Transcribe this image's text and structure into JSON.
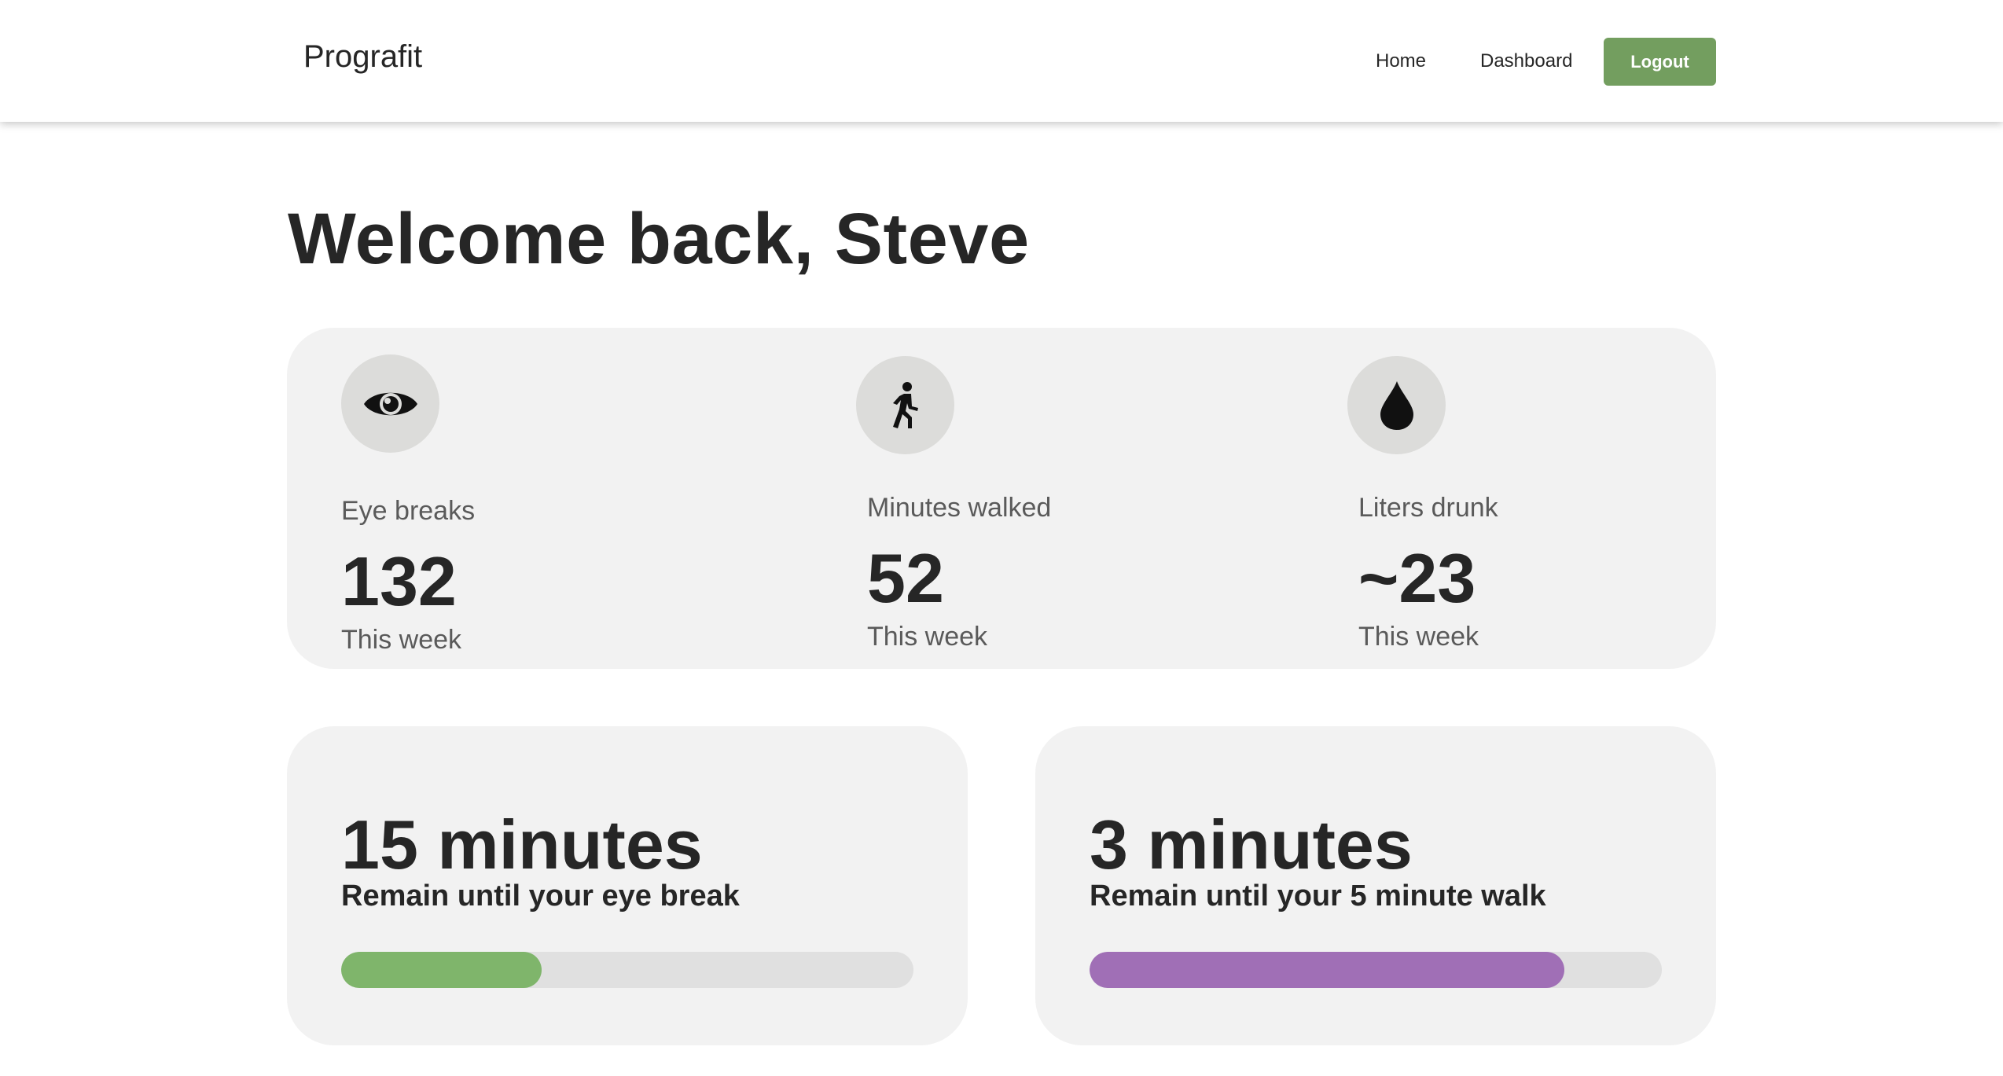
{
  "nav": {
    "brand": "Prografit",
    "links": [
      "Home",
      "Dashboard"
    ],
    "logout_label": "Logout",
    "accent_color": "#739e5f"
  },
  "welcome": "Welcome back, Steve",
  "stats": [
    {
      "icon": "eye-icon",
      "label": "Eye breaks",
      "value": "132",
      "sub": "This week"
    },
    {
      "icon": "walking-person-icon",
      "label": "Minutes walked",
      "value": "52",
      "sub": "This week"
    },
    {
      "icon": "water-drop-icon",
      "label": "Liters drunk",
      "value": "~23",
      "sub": "This week"
    }
  ],
  "timers": [
    {
      "value": "15 minutes",
      "desc": "Remain until your eye break",
      "progress": 0.35,
      "color": "#7fb56b"
    },
    {
      "value": "3 minutes",
      "desc": "Remain until your 5 minute walk",
      "progress": 0.83,
      "color": "#a06fb6"
    }
  ]
}
